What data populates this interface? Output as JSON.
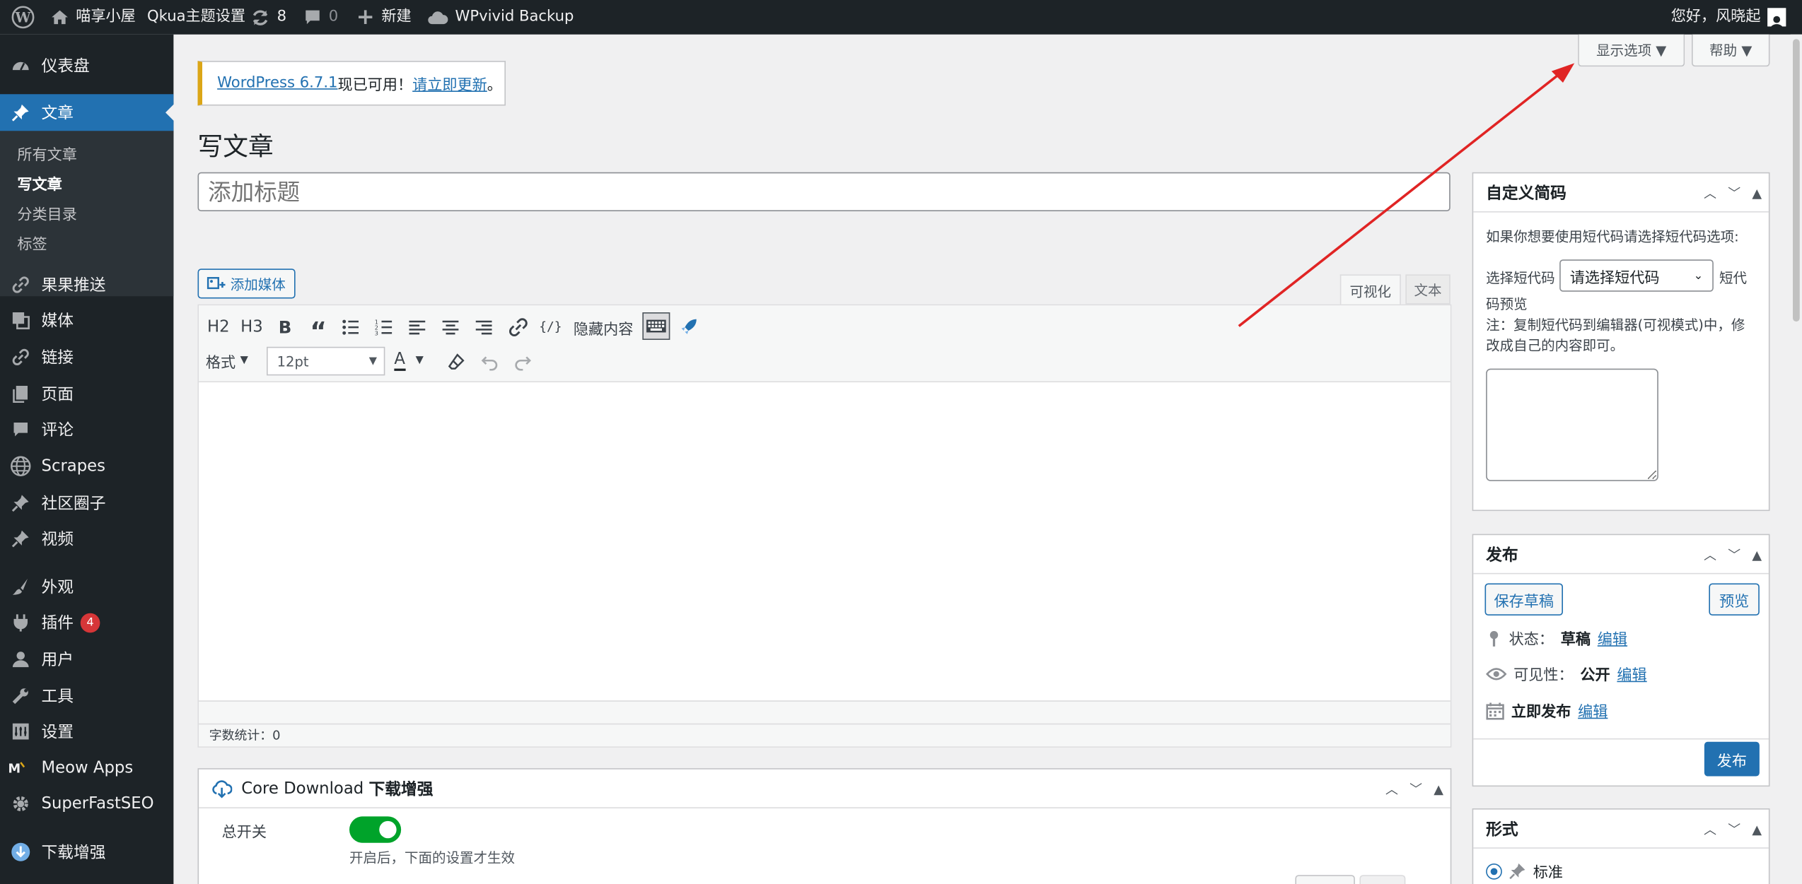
{
  "admin_bar": {
    "site_name": "喵享小屋",
    "theme_settings": "Qkua主题设置",
    "updates_count": "8",
    "comments_count": "0",
    "new_label": "新建",
    "backup_label": "WPvivid Backup",
    "greeting": "您好，风晓起"
  },
  "sidebar": {
    "items": [
      {
        "label": "仪表盘",
        "icon": "dashboard-icon"
      },
      {
        "label": "文章",
        "icon": "pushpin-icon"
      },
      {
        "label": "果果推送",
        "icon": "link-icon"
      },
      {
        "label": "媒体",
        "icon": "media-icon"
      },
      {
        "label": "链接",
        "icon": "link-icon"
      },
      {
        "label": "页面",
        "icon": "page-icon"
      },
      {
        "label": "评论",
        "icon": "comment-icon"
      },
      {
        "label": "Scrapes",
        "icon": "globe-icon"
      },
      {
        "label": "社区圈子",
        "icon": "pushpin-icon"
      },
      {
        "label": "视频",
        "icon": "pushpin-icon"
      },
      {
        "label": "外观",
        "icon": "brush-icon"
      },
      {
        "label": "插件",
        "icon": "plugin-icon",
        "badge": "4"
      },
      {
        "label": "用户",
        "icon": "user-icon"
      },
      {
        "label": "工具",
        "icon": "wrench-icon"
      },
      {
        "label": "设置",
        "icon": "settings-icon"
      },
      {
        "label": "Meow Apps",
        "icon": "meow-icon"
      },
      {
        "label": "SuperFastSEO",
        "icon": "gear-icon"
      },
      {
        "label": "下载增强",
        "icon": "download-icon"
      }
    ],
    "submenu": [
      "所有文章",
      "写文章",
      "分类目录",
      "标签"
    ]
  },
  "screen_options": {
    "display": "显示选项 ▼",
    "help": "帮助 ▼"
  },
  "notice": {
    "version_link": "WordPress 6.7.1",
    "text": " 现已可用！",
    "update_link": "请立即更新",
    "end": "。"
  },
  "page_title": "写文章",
  "title_input": {
    "placeholder": "添加标题"
  },
  "editor": {
    "add_media": "添加媒体",
    "tab_visual": "可视化",
    "tab_text": "文本",
    "toolbar1": [
      "H2",
      "H3",
      "B",
      "“",
      "hidden_content"
    ],
    "hidden_content": "隐藏内容",
    "format_label": "格式",
    "font_size": "12pt",
    "font_color_label": "A",
    "word_count": "字数统计：0"
  },
  "shortcode_box": {
    "title": "自定义简码",
    "intro": "如果你想要使用短代码请选择短代码选项:",
    "select_label": "选择短代码",
    "select_value": "请选择短代码",
    "preview_label_1": "短代",
    "preview_label_2": "码预览",
    "note": "注：复制短代码到编辑器(可视模式)中，修改成自己的内容即可。"
  },
  "publish_box": {
    "title": "发布",
    "save_draft": "保存草稿",
    "preview": "预览",
    "status_label": "状态：",
    "status_value": "草稿",
    "visibility_label": "可见性：",
    "visibility_value": "公开",
    "schedule_value": "立即发布",
    "edit": "编辑",
    "publish": "发布"
  },
  "format_box": {
    "title": "形式",
    "option_standard": "标准"
  },
  "core_download": {
    "title_prefix": "Core Download ",
    "title_suffix": "下载增强",
    "switch_label": "总开关",
    "switch_on": true,
    "switch_hint": "开启后，下面的设置才生效"
  },
  "colors": {
    "accent": "#2271b1",
    "admin_bar": "#1d2327",
    "notice": "#dba617",
    "switch": "#00a32a",
    "arrow": "#e02424"
  }
}
